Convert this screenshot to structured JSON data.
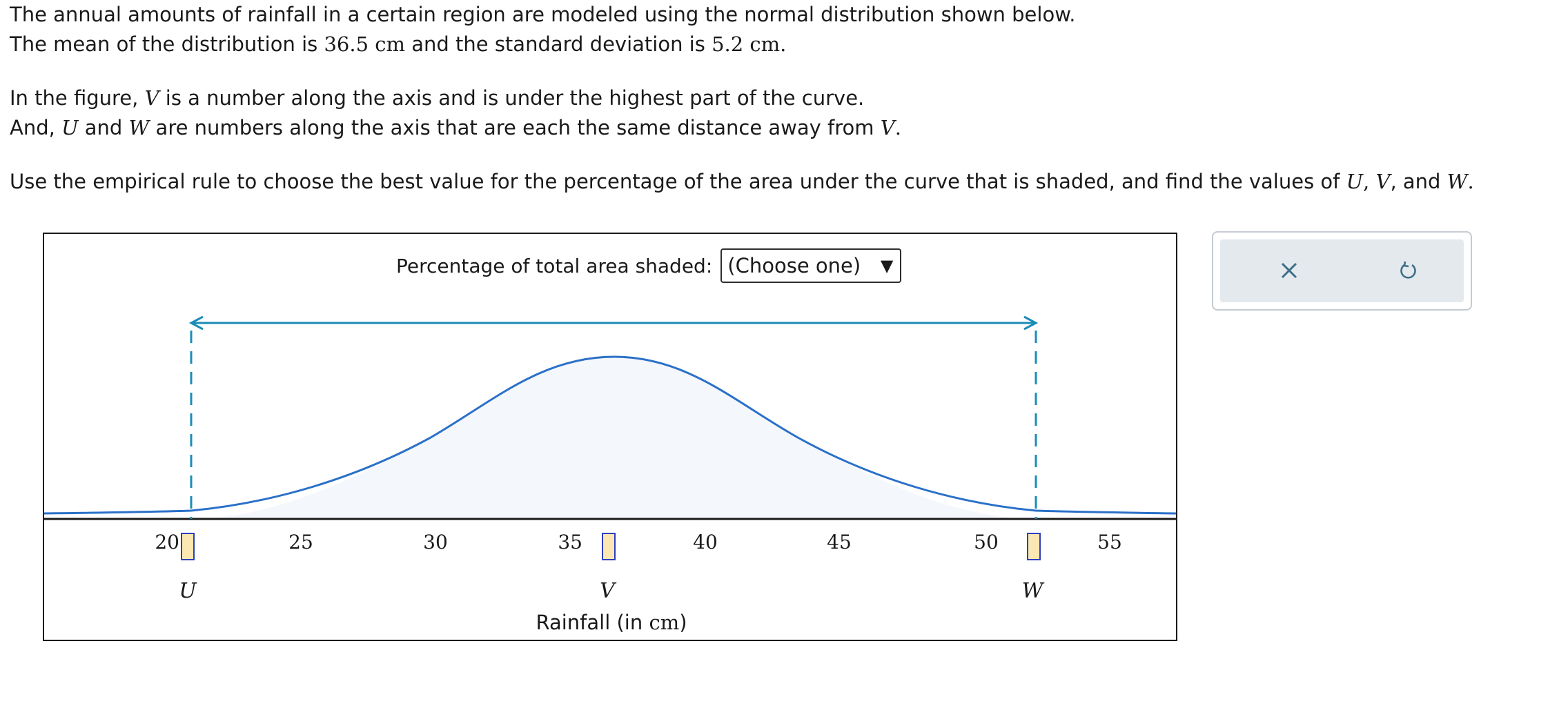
{
  "intro": {
    "line1": "The annual amounts of rainfall in a certain region are modeled using the normal distribution shown below.",
    "line2_a": "The mean of the distribution is ",
    "mean_value": "36.5",
    "unit": "cm",
    "line2_b": " and the standard deviation is ",
    "sd_value": "5.2",
    "line3_a": "In the figure, ",
    "var_v": "V",
    "line3_b": " is a number along the axis and is under the highest part of the curve.",
    "line4_a": "And, ",
    "var_u": "U",
    "line4_and": " and ",
    "var_w": "W",
    "line4_b": " are numbers along the axis that are each the same distance away from ",
    "line5_a": "Use the empirical rule to choose the best value for the percentage of the area under the curve that is shaded, and find the values of ",
    "line5_and": ", and "
  },
  "question": {
    "percentage_label": "Percentage of total area shaded:",
    "select_value": "(Choose one)",
    "select_arrow": "▼"
  },
  "figure": {
    "tick_labels": [
      "20",
      "25",
      "30",
      "35",
      "40",
      "45",
      "50",
      "55"
    ],
    "u_label": "U",
    "v_label": "V",
    "w_label": "W",
    "axis_title": "Rainfall (in ",
    "axis_unit": "cm",
    "axis_close": ")",
    "colors": {
      "curve": "#2a70c8",
      "shade": "#f4f7fc",
      "arrow": "#1a8cb8",
      "answer_box": "#fbe7b1",
      "answer_border": "#2e3ec0"
    }
  },
  "tools": {
    "clear_icon": "close-icon",
    "reset_icon": "undo-icon"
  }
}
